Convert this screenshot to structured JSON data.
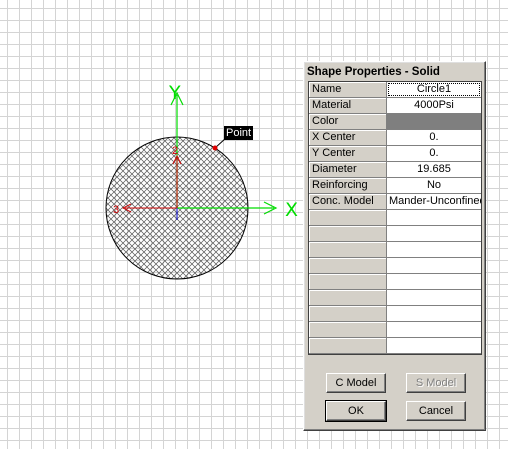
{
  "canvas": {
    "axes": {
      "x_label": "X",
      "y_label": "Y",
      "num_2": "2",
      "num_3": "3"
    },
    "point_label": "Point",
    "colors": {
      "x_axis": "#00dd00",
      "y_axis": "#00dd00",
      "axis_2": "#cc0000",
      "axis_3": "#cc0000",
      "hatch": "#555555",
      "point": "#dd0000"
    }
  },
  "dialog": {
    "title": "Shape Properties - Solid",
    "properties": [
      {
        "name": "Name",
        "value": "Circle1"
      },
      {
        "name": "Material",
        "value": "4000Psi"
      },
      {
        "name": "Color",
        "value": ""
      },
      {
        "name": "X Center",
        "value": "0."
      },
      {
        "name": "Y Center",
        "value": "0."
      },
      {
        "name": "Diameter",
        "value": "19.685"
      },
      {
        "name": "Reinforcing",
        "value": "No"
      },
      {
        "name": "Conc. Model",
        "value": "Mander-Unconfined"
      },
      {
        "name": "",
        "value": ""
      },
      {
        "name": "",
        "value": ""
      },
      {
        "name": "",
        "value": ""
      },
      {
        "name": "",
        "value": ""
      },
      {
        "name": "",
        "value": ""
      },
      {
        "name": "",
        "value": ""
      },
      {
        "name": "",
        "value": ""
      },
      {
        "name": "",
        "value": ""
      },
      {
        "name": "",
        "value": ""
      }
    ],
    "buttons": {
      "c_model": "C Model",
      "s_model": "S Model",
      "ok": "OK",
      "cancel": "Cancel"
    }
  }
}
